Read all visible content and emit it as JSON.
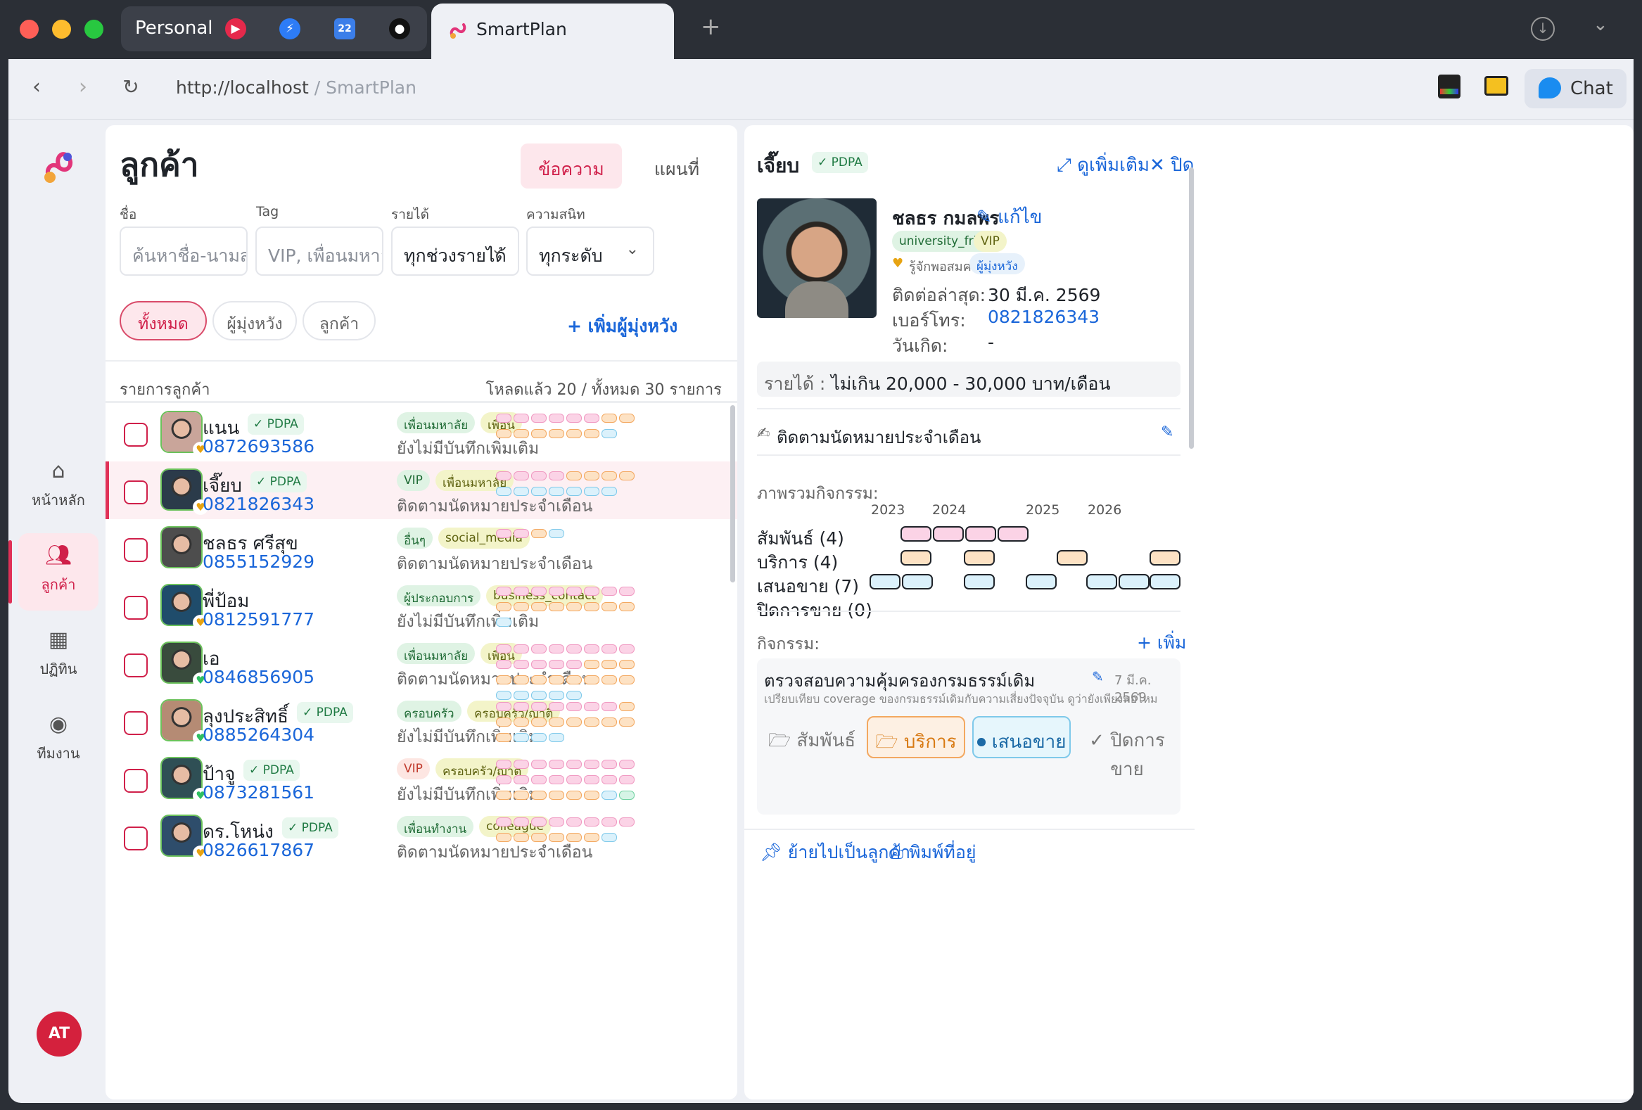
{
  "browser": {
    "tab_group": "Personal",
    "active_tab": "SmartPlan",
    "new_tab_symbol": "+",
    "url_host": "http://localhost",
    "url_sep": " / ",
    "url_path": "SmartPlan",
    "chat_label": "Chat"
  },
  "sidebar": {
    "items": [
      {
        "label": "หน้าหลัก",
        "icon": "home-icon"
      },
      {
        "label": "ลูกค้า",
        "icon": "users-icon"
      },
      {
        "label": "ปฏิทิน",
        "icon": "calendar-icon"
      },
      {
        "label": "ทีมงาน",
        "icon": "team-icon"
      }
    ],
    "avatar": "AT"
  },
  "list": {
    "title": "ลูกค้า",
    "view_tabs": [
      "ข้อความ",
      "แผนที่"
    ],
    "filters": {
      "name_label": "ชื่อ",
      "name_placeholder": "ค้นหาชื่อ-นามสกุล",
      "tag_label": "Tag",
      "tag_placeholder": "VIP, เพื่อนมหาลัย, ลู",
      "income_label": "รายได้",
      "income_value": "ทุกช่วงรายได้",
      "interest_label": "ความสนิท",
      "interest_value": "ทุกระดับ"
    },
    "segments": [
      "ทั้งหมด",
      "ผู้มุ่งหวัง",
      "ลูกค้า"
    ],
    "add_prospect": "+ เพิ่มผู้มุ่งหวัง",
    "header_left": "รายการลูกค้า",
    "header_right": "โหลดแล้ว 20 / ทั้งหมด 30 รายการ",
    "rows": [
      {
        "name": "แนน",
        "pdpa": "PDPA",
        "phone": "0872693586",
        "tags": [
          "เพื่อนมหาลัย",
          "เพื่อน"
        ],
        "note": "ยังไม่มีบันทึกเพิ่มเติม",
        "heart": "yellow",
        "chips": "ppppppoooooooo|b"
      },
      {
        "name": "เจี๊ยบ",
        "pdpa": "PDPA",
        "phone": "0821826343",
        "tags": [
          "VIP",
          "เพื่อนมหาลัย"
        ],
        "note": "ติดตามนัดหมายประจำเดือน",
        "heart": "yellow",
        "chips": "ppppoooobbbbbbb"
      },
      {
        "name": "ชลธร ศรีสุข",
        "pdpa": "",
        "phone": "0855152929",
        "tags": [
          "อื่นๆ",
          "social_media"
        ],
        "note": "ติดตามนัดหมายประจำเดือน",
        "heart": "",
        "chips": "ppob"
      },
      {
        "name": "พี่ป้อม",
        "pdpa": "",
        "phone": "0812591777",
        "tags": [
          "ผู้ประกอบการ",
          "business_contact"
        ],
        "note": "ยังไม่มีบันทึกเพิ่มเติม",
        "heart": "yellow",
        "chips": "ppppppppoooooooob"
      },
      {
        "name": "เอ",
        "pdpa": "",
        "phone": "0846856905",
        "tags": [
          "เพื่อนมหาลัย",
          "เพื่อน"
        ],
        "note": "ติดตามนัดหมายประจำเดือน",
        "heart": "green",
        "chips": "pppppppppppppooooooooooobbbbb"
      },
      {
        "name": "ลุงประสิทธิ์",
        "pdpa": "PDPA",
        "phone": "0885264304",
        "tags": [
          "ครอบครัว",
          "ครอบครัว/ญาติ"
        ],
        "note": "ยังไม่มีบันทึกเพิ่มเติม",
        "heart": "green",
        "chips": "pppppppoooooooooobbb"
      },
      {
        "name": "ป้าจู",
        "pdpa": "PDPA",
        "phone": "0873281561",
        "tags": [
          "VIP",
          "ครอบครัว/ญาติ"
        ],
        "note": "ยังไม่มีบันทึกเพิ่มเติม",
        "heart": "green",
        "chips": "ppppppppppppppppoooooobg"
      },
      {
        "name": "ดร.โหน่ง",
        "pdpa": "PDPA",
        "phone": "0826617867",
        "tags": [
          "เพื่อนทำงาน",
          "colleague"
        ],
        "note": "ติดตามนัดหมายประจำเดือน",
        "heart": "yellow",
        "chips": "ppppppppoooooob"
      }
    ]
  },
  "detail": {
    "nick": "เจี๊ยบ",
    "pdpa": "PDPA",
    "see_more": "ดูเพิ่มเติม",
    "close": "ปิด",
    "fullname": "ชลธร กมลพร",
    "edit": "แก้ไข",
    "tags": [
      "university_friend",
      "VIP"
    ],
    "closeness": "รู้จักพอสมควร",
    "status": "ผู้มุ่งหวัง",
    "last_contact_label": "ติดต่อล่าสุด:",
    "last_contact_value": "30 มี.ค. 2569",
    "phone_label": "เบอร์โทร:",
    "phone_value": "0821826343",
    "birthday_label": "วันเกิด:",
    "birthday_value": "-",
    "income_label": "รายได้ : ",
    "income_value": "ไม่เกิน 20,000 - 30,000 บาท/เดือน",
    "followup_note": "ติดตามนัดหมายประจำเดือน",
    "overview_title": "ภาพรวมกิจกรรม:",
    "years": [
      "2023",
      "2024",
      "2025",
      "2026"
    ],
    "timeline": [
      {
        "label": "สัมพันธ์ (4)"
      },
      {
        "label": "บริการ (4)"
      },
      {
        "label": "เสนอขาย (7)"
      },
      {
        "label": "ปิดการขาย (0)"
      }
    ],
    "activities_title": "กิจกรรม:",
    "add": "+ เพิ่ม",
    "activity": {
      "title": "ตรวจสอบความคุ้มครองกรมธรรม์เดิม",
      "date": "7 มี.ค. 2569",
      "desc": "เปรียบเทียบ coverage ของกรมธรรม์เดิมกับความเสี่ยงปัจจุบัน ดูว่ายังเพียงพอไหม",
      "buttons": [
        "สัมพันธ์",
        "บริการ",
        "เสนอขาย",
        "ปิดการขาย"
      ]
    },
    "footer": [
      "ย้ายไปเป็นลูกค้า",
      "พิมพ์ที่อยู่"
    ]
  },
  "colors": {
    "accent": "#d0204a",
    "link": "#1a66d9",
    "relation": "#f7b6d4",
    "service": "#fcd0a1",
    "offer": "#bfe6f6"
  }
}
